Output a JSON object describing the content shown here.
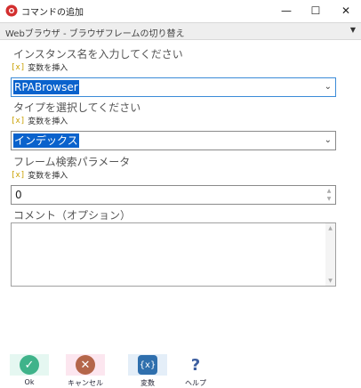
{
  "window": {
    "title": "コマンドの追加",
    "min_glyph": "—",
    "max_glyph": "☐",
    "close_glyph": "✕"
  },
  "category": {
    "text": "Webブラウザ - ブラウザフレームの切り替え",
    "arrow": "▼"
  },
  "fields": {
    "instance": {
      "label": "インスタンス名を入力してください",
      "insert_var": "変数を挿入",
      "value": "RPABrowser"
    },
    "type": {
      "label": "タイプを選択してください",
      "insert_var": "変数を挿入",
      "value": "インデックス"
    },
    "frame": {
      "label": "フレーム検索パラメータ",
      "insert_var": "変数を挿入",
      "value": "0"
    },
    "comment": {
      "label": "コメント（オプション）",
      "value": ""
    }
  },
  "icons": {
    "x_glyph": "[x]",
    "combo_arrow": "⌄",
    "spin_up": "▲",
    "spin_down": "▼",
    "ok_glyph": "✓",
    "cancel_glyph": "✕",
    "variable_glyph": "{x}",
    "help_glyph": "?"
  },
  "footer": {
    "ok": "Ok",
    "cancel": "キャンセル",
    "variable": "変数",
    "help": "ヘルプ"
  },
  "colors": {
    "selection": "#0a62cc",
    "ok": "#3fb38a",
    "cancel": "#b4664a",
    "variable": "#2f6fad",
    "help": "#3d5fa0",
    "accent_x": "#c9a000"
  }
}
